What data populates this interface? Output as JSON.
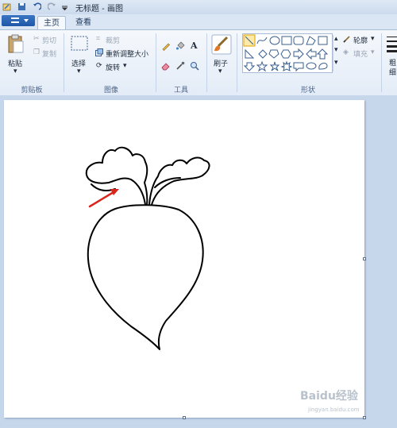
{
  "window": {
    "title": "无标题 - 画图"
  },
  "tabs": [
    {
      "label": "主页",
      "active": true
    },
    {
      "label": "查看",
      "active": false
    }
  ],
  "clipboard": {
    "paste": "粘贴",
    "cut": "剪切",
    "copy": "复制",
    "group": "剪贴板"
  },
  "image": {
    "select": "选择",
    "crop": "裁剪",
    "resize": "重新调整大小",
    "rotate": "旋转",
    "group": "图像"
  },
  "tools": {
    "group": "工具",
    "text_glyph": "A"
  },
  "brushes": {
    "label": "刷子"
  },
  "shapes": {
    "outline": "轮廓",
    "fill": "填充",
    "group": "形状"
  },
  "partial_right": {
    "line1": "粗",
    "line2": "细"
  },
  "watermark": {
    "text": "Baidu经验",
    "sub": "jingyan.baidu.com"
  },
  "colors": {
    "accent": "#1e57a8",
    "arrow": "#d9261c",
    "drawing_stroke": "#000000"
  }
}
